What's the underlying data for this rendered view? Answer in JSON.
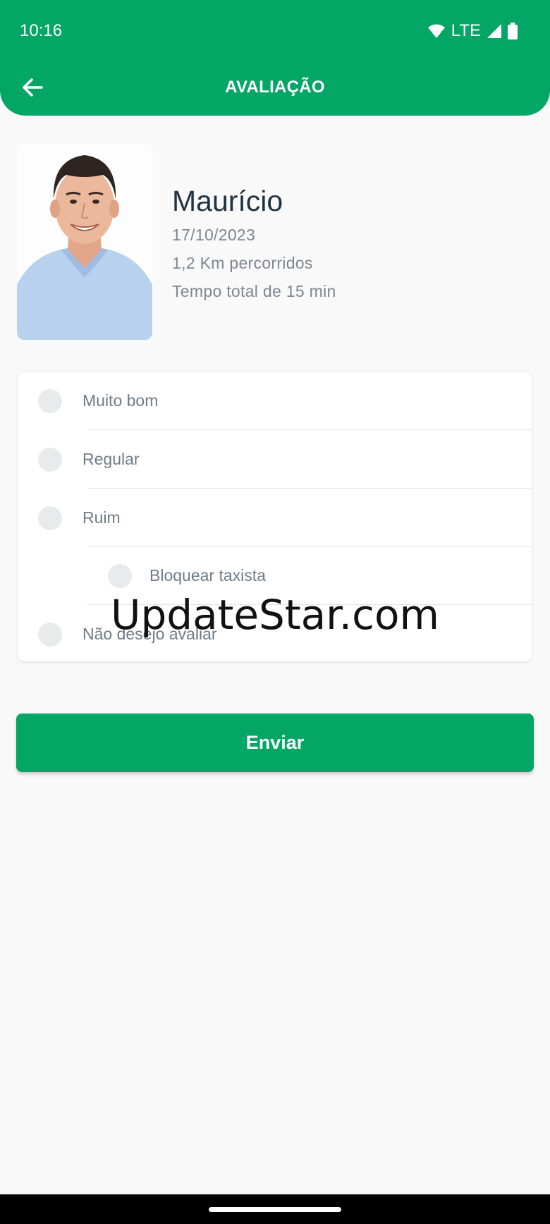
{
  "status_bar": {
    "time": "10:16",
    "network": "LTE",
    "icons": [
      "wifi-icon",
      "signal-icon",
      "battery-icon"
    ]
  },
  "header": {
    "title": "AVALIAÇÃO",
    "back_icon": "arrow-left-icon",
    "color": "#03a665"
  },
  "driver": {
    "name": "Maurício",
    "date": "17/10/2023",
    "distance": "1,2 Km percorridos",
    "duration": "Tempo total de 15 min"
  },
  "options": [
    {
      "label": "Muito bom",
      "selected": false
    },
    {
      "label": "Regular",
      "selected": false
    },
    {
      "label": "Ruim",
      "selected": false
    },
    {
      "label": "Bloquear taxista",
      "selected": false,
      "nested": true
    },
    {
      "label": "Não desejo avaliar",
      "selected": false
    }
  ],
  "watermark": "UpdateStar.com",
  "submit_label": "Enviar"
}
